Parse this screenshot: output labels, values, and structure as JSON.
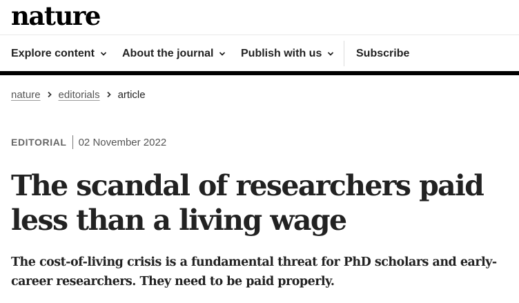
{
  "header": {
    "logo_text": "nature"
  },
  "nav": {
    "items": [
      {
        "label": "Explore content",
        "has_dropdown": true
      },
      {
        "label": "About the journal",
        "has_dropdown": true
      },
      {
        "label": "Publish with us",
        "has_dropdown": true
      },
      {
        "label": "Subscribe",
        "has_dropdown": false
      }
    ]
  },
  "breadcrumb": {
    "items": [
      {
        "label": "nature",
        "link": true
      },
      {
        "label": "editorials",
        "link": true
      },
      {
        "label": "article",
        "link": false
      }
    ],
    "separator_icon": "chevron-right-icon"
  },
  "article": {
    "type": "EDITORIAL",
    "date": "02 November 2022",
    "title": "The scandal of researchers paid less than a living wage",
    "standfirst": "The cost-of-living crisis is a fundamental threat for PhD scholars and early-career researchers. They need to be paid properly."
  },
  "colors": {
    "text": "#222222",
    "bar": "#000000",
    "muted": "#666666"
  }
}
